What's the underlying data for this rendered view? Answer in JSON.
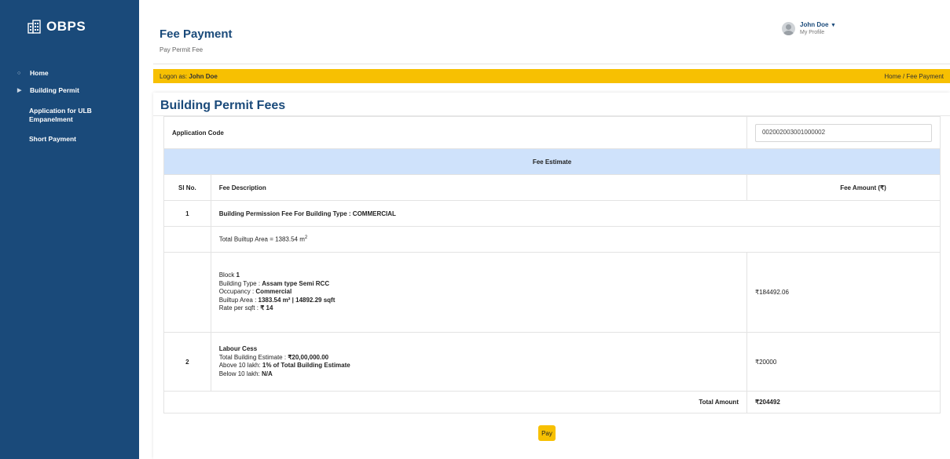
{
  "app": {
    "logo_text": "OBPS"
  },
  "sidebar": {
    "items": [
      {
        "label": "Home"
      },
      {
        "label": "Building Permit"
      },
      {
        "label": "Application for ULB Empanelment"
      },
      {
        "label": "Short Payment"
      }
    ]
  },
  "header": {
    "title": "Fee Payment",
    "subtitle": "Pay Permit Fee",
    "user_name": "John Doe",
    "profile_link": "My Profile"
  },
  "logon_bar": {
    "prefix": "Logon as:",
    "user": "John Doe",
    "breadcrumb": "Home / Fee Payment"
  },
  "card": {
    "title": "Building Permit Fees",
    "app_code_label": "Application Code",
    "app_code_value": "002002003001000002",
    "estimate_header": "Fee Estimate",
    "columns": {
      "sl": "Sl No.",
      "desc": "Fee Description",
      "amount": "Fee Amount (₹)"
    },
    "fee1": {
      "sl": "1",
      "title": "Building Permission Fee For Building Type : COMMERCIAL",
      "area_line": "Total Builtup Area = 1383.54 m",
      "area_sup": "2",
      "block_label": "Block",
      "block_no": "1",
      "building_type_label": "Building Type :",
      "building_type": "Assam type Semi RCC",
      "occupancy_label": "Occupancy :",
      "occupancy": "Commercial",
      "builtup_label": "Builtup Area :",
      "builtup_value": "1383.54 m² | 14892.29 sqft",
      "rate_label": "Rate per sqft :",
      "rate_value": "₹ 14",
      "amount": "₹184492.06"
    },
    "fee2": {
      "sl": "2",
      "title": "Labour Cess",
      "estimate_label": "Total Building Estimate :",
      "estimate_value": "₹20,00,000.00",
      "above_label": "Above 10 lakh:",
      "above_value": "1% of Total Building Estimate",
      "below_label": "Below 10 lakh:",
      "below_value": "N/A",
      "amount": "₹20000"
    },
    "total_label": "Total Amount",
    "total_value": "₹204492",
    "pay_label": "Pay"
  },
  "colors": {
    "sidebar": "#1a4a7a",
    "accent_yellow": "#f7c002",
    "estimate_bg": "#cfe2fb",
    "title_blue": "#1a4a7a"
  }
}
